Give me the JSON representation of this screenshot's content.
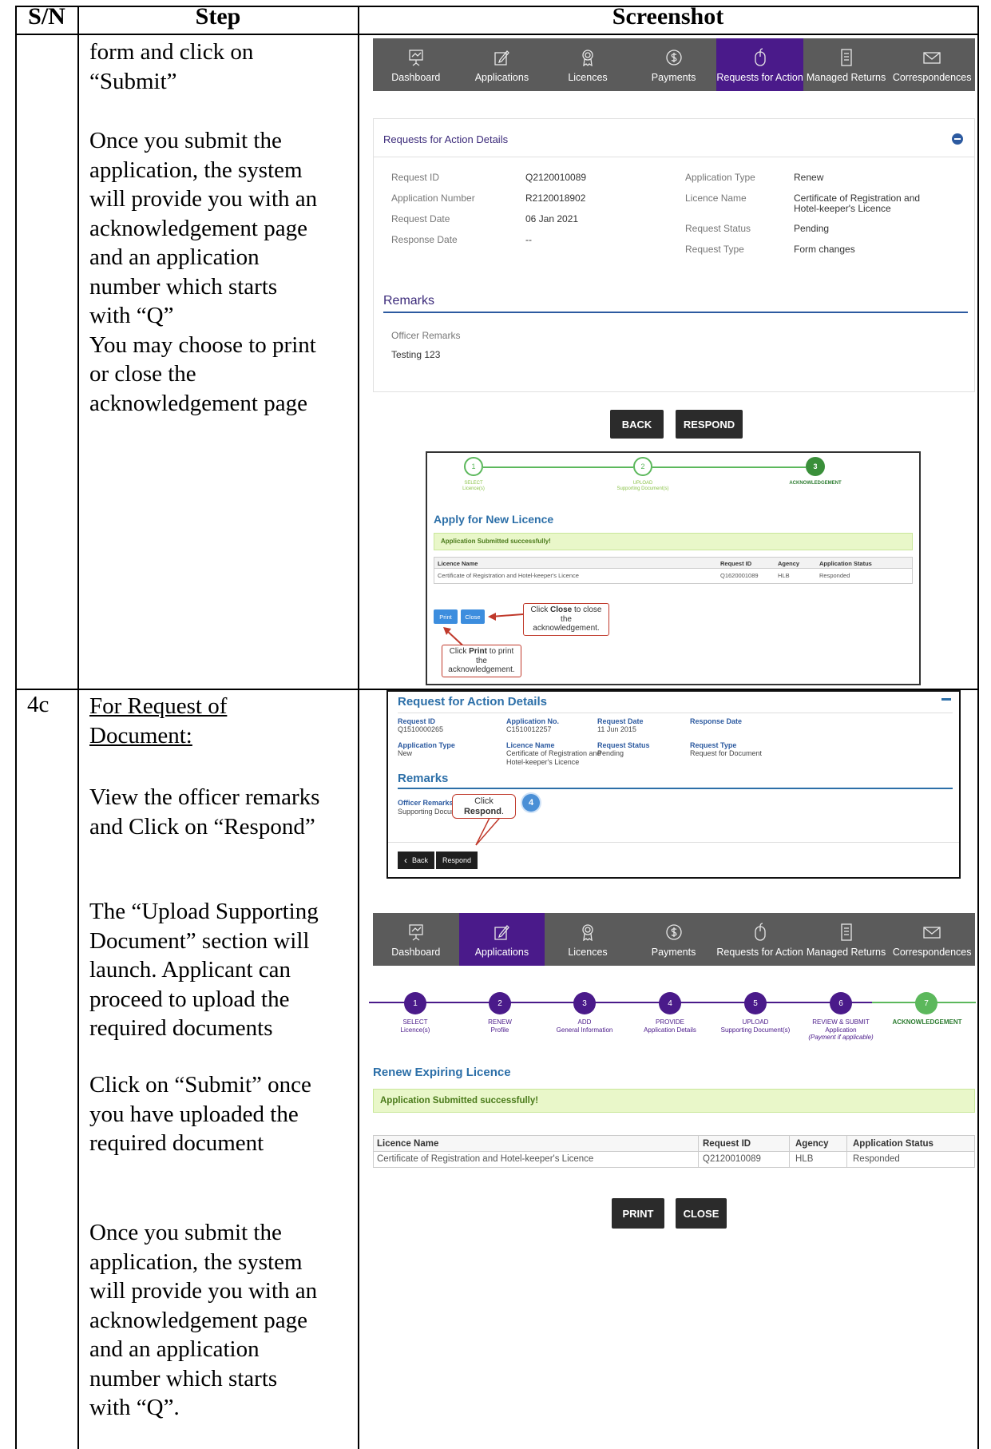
{
  "table": {
    "headers": {
      "sn": "S/N",
      "step": "Step",
      "screenshot": "Screenshot"
    }
  },
  "row1": {
    "step_lines_top": [
      "form and click on",
      "“Submit”"
    ],
    "step_lines_mid": [
      "Once you submit the",
      "application, the system",
      "will provide you with an",
      "acknowledgement page",
      "and an application",
      "number which starts",
      "with “Q”",
      "You may choose to print",
      "or close the",
      "acknowledgement page"
    ]
  },
  "row2": {
    "sn": "4c",
    "heading_lines": [
      "For Request of",
      "Document:"
    ],
    "para1": [
      "View the officer remarks",
      "and Click on “Respond”"
    ],
    "para2": [
      "The “Upload Supporting",
      "Document” section will",
      "launch. Applicant can",
      "proceed to upload the",
      "required documents"
    ],
    "para3": [
      "Click on “Submit” once",
      "you have uploaded the",
      "required document"
    ],
    "para4": [
      "Once you submit the",
      "application, the system",
      "will provide you with an",
      "acknowledgement page",
      "and an application",
      "number which starts",
      "with “Q”."
    ]
  },
  "nav": {
    "items": [
      {
        "label": "Dashboard",
        "icon": "presentation-board-icon"
      },
      {
        "label": "Applications",
        "icon": "edit-icon"
      },
      {
        "label": "Licences",
        "icon": "rosette-icon"
      },
      {
        "label": "Payments",
        "icon": "dollar-icon"
      },
      {
        "label": "Requests for Action",
        "icon": "mouse-icon"
      },
      {
        "label": "Managed Returns",
        "icon": "document-icon"
      },
      {
        "label": "Correspondences",
        "icon": "envelope-icon"
      }
    ],
    "active_top": "Requests for Action",
    "active_bottom": "Applications",
    "active_color": "#4a1a8a"
  },
  "details": {
    "title": "Requests for Action Details",
    "left_labels": [
      "Request ID",
      "Application Number",
      "Request Date",
      "Response Date"
    ],
    "left_values": [
      "Q2120010089",
      "R2120018902",
      "06 Jan 2021",
      "--"
    ],
    "right_labels": [
      "Application Type",
      "Licence Name",
      "Request Status",
      "Request Type"
    ],
    "right_values": [
      "Renew",
      "Certificate of Registration and",
      "Pending",
      "Form changes"
    ],
    "licence_name_line2": "Hotel-keeper's Licence",
    "remarks_heading": "Remarks",
    "officer_remarks_label": "Officer Remarks",
    "officer_remarks_value": "Testing 123",
    "back": "BACK",
    "respond": "RESPOND"
  },
  "ack1": {
    "steps": [
      {
        "num": "1",
        "line1": "SELECT",
        "line2": "Licence(s)"
      },
      {
        "num": "2",
        "line1": "UPLOAD",
        "line2": "Supporting Document(s)"
      },
      {
        "num": "3",
        "line1": "ACKNOWLEDGEMENT",
        "line2": ""
      }
    ],
    "title": "Apply for New Licence",
    "success": "Application Submitted successfully!",
    "columns": [
      "Licence Name",
      "Request ID",
      "Agency",
      "Application Status"
    ],
    "row": [
      "Certificate of Registration and Hotel-keeper's Licence",
      "Q1620001089",
      "HLB",
      "Responded"
    ],
    "print": "Print",
    "close": "Close",
    "callout_close_pre": "Click ",
    "callout_close_bold": "Close",
    "callout_close_post": " to close the",
    "callout_close_line2": "acknowledgement.",
    "callout_print_pre": "Click ",
    "callout_print_bold": "Print",
    "callout_print_post": " to print the",
    "callout_print_line2": "acknowledgement."
  },
  "rfa": {
    "title": "Request for Action Details",
    "fields_row1": [
      {
        "label": "Request ID",
        "value": "Q1510000265"
      },
      {
        "label": "Application No.",
        "value": "C1510012257"
      },
      {
        "label": "Request Date",
        "value": "11 Jun 2015"
      },
      {
        "label": "Response Date",
        "value": ""
      }
    ],
    "fields_row2": [
      {
        "label": "Application Type",
        "value": "New"
      },
      {
        "label": "Licence Name",
        "value": "Certificate of Registration and"
      },
      {
        "label": "Request Status",
        "value": "Pending"
      },
      {
        "label": "Request Type",
        "value": "Request for Document"
      }
    ],
    "licence_name_line2": "Hotel-keeper's Licence",
    "remarks_heading": "Remarks",
    "officer_remarks_label": "Officer Remarks",
    "officer_remarks_value": "Supporting Document Required.",
    "callout_pre": "Click ",
    "callout_bold": "Respond",
    "callout_post": ".",
    "badge": "4",
    "back": "Back",
    "respond": "Respond"
  },
  "renew": {
    "steps": [
      {
        "num": "1",
        "line1": "SELECT",
        "line2": "Licence(s)",
        "line3": ""
      },
      {
        "num": "2",
        "line1": "RENEW",
        "line2": "Profile",
        "line3": ""
      },
      {
        "num": "3",
        "line1": "ADD",
        "line2": "General Information",
        "line3": ""
      },
      {
        "num": "4",
        "line1": "PROVIDE",
        "line2": "Application Details",
        "line3": ""
      },
      {
        "num": "5",
        "line1": "UPLOAD",
        "line2": "Supporting Document(s)",
        "line3": ""
      },
      {
        "num": "6",
        "line1": "REVIEW & SUBMIT",
        "line2": "Application",
        "line3": "(Payment if applicable)"
      },
      {
        "num": "7",
        "line1": "ACKNOWLEDGEMENT",
        "line2": "",
        "line3": ""
      }
    ],
    "title": "Renew Expiring Licence",
    "success": "Application Submitted successfully!",
    "columns": [
      "Licence Name",
      "Request ID",
      "Agency",
      "Application Status"
    ],
    "row": [
      "Certificate of Registration and Hotel-keeper's Licence",
      "Q2120010089",
      "HLB",
      "Responded"
    ],
    "print": "PRINT",
    "close": "CLOSE"
  },
  "colors": {
    "purple": "#4a1a8a",
    "green": "#5cb85c",
    "blue_heading": "#2c6fa8",
    "success_bg": "#e9f7c9"
  }
}
